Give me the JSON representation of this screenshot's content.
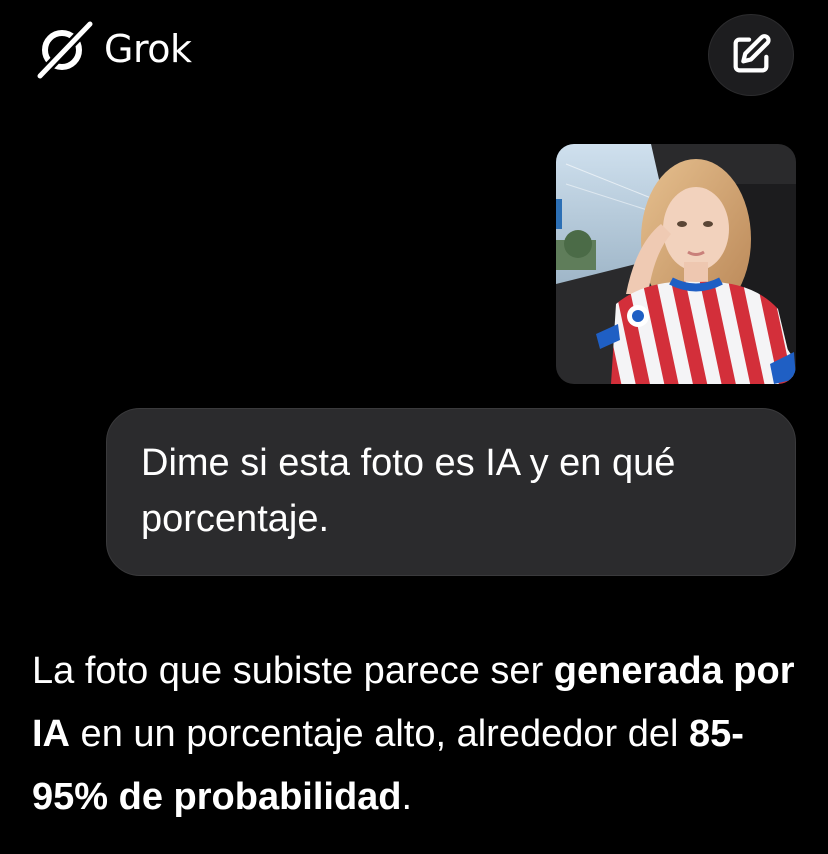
{
  "header": {
    "app_name": "Grok",
    "logo_icon": "grok-logo-icon",
    "new_chat_icon": "edit-icon"
  },
  "conversation": {
    "attachment": {
      "kind": "photo",
      "icon": "attached-photo-thumbnail"
    },
    "user_message": {
      "text": "Dime si esta foto es IA y en qué porcentaje."
    },
    "assistant_message": {
      "part1": "La foto que subiste parece ser ",
      "bold1": "generada por IA",
      "part2": " en un porcentaje alto, alrededor del ",
      "bold2": "85-95% de probabilidad",
      "part3": "."
    }
  },
  "colors": {
    "background": "#000000",
    "bubble": "#2b2b2d",
    "text": "#ffffff"
  }
}
